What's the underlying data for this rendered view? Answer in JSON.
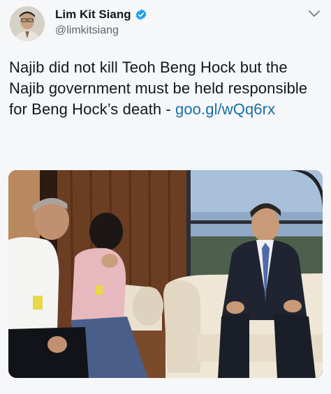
{
  "tweet": {
    "author_name": "Lim Kit Siang",
    "author_handle": "@limkitsiang",
    "text": "Najib did not kill Teoh Beng Hock but the Najib government must be held responsible for Beng Hock’s death - ",
    "link": "goo.gl/wQq6rx"
  },
  "icons": {
    "verified": "verified-badge-icon",
    "more": "chevron-down-icon"
  },
  "colors": {
    "link": "#1b6fa8",
    "verified": "#1da1f2"
  }
}
